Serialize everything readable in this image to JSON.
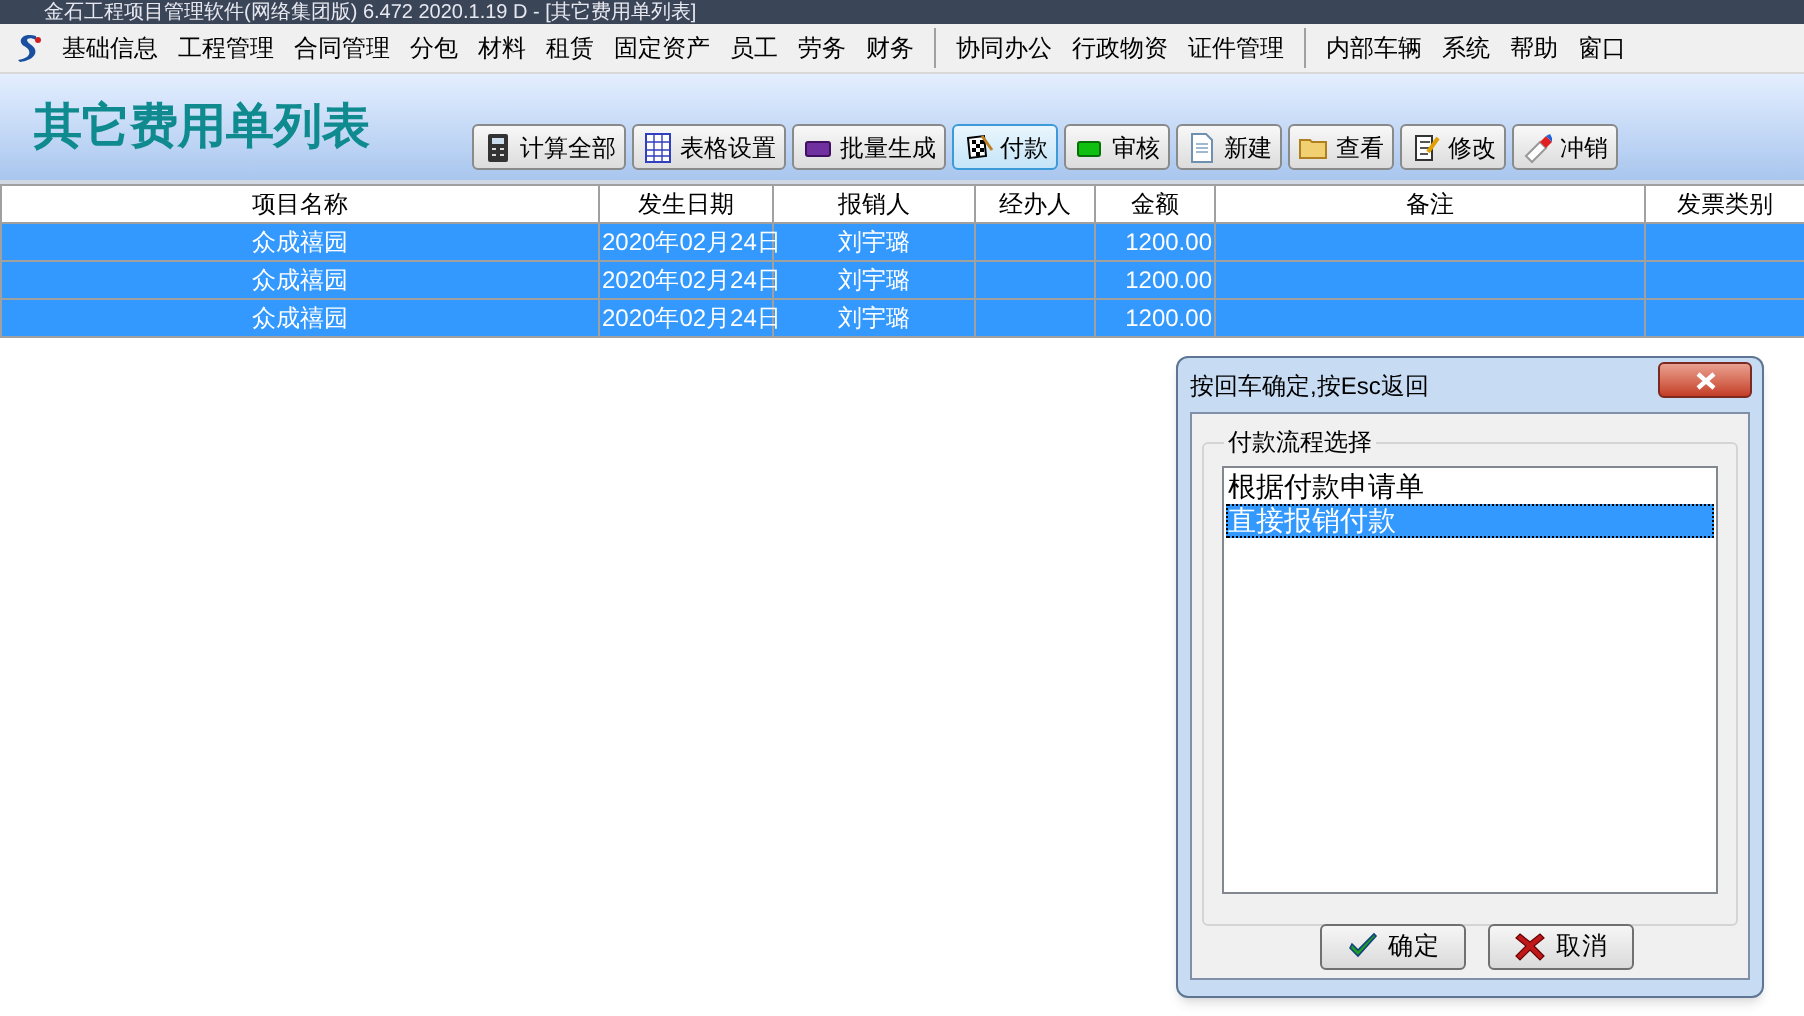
{
  "window": {
    "title": "金石工程项目管理软件(网络集团版) 6.472  2020.1.19 D - [其它费用单列表]"
  },
  "menu": [
    {
      "label": "基础信息"
    },
    {
      "label": "工程管理"
    },
    {
      "label": "合同管理"
    },
    {
      "label": "分包"
    },
    {
      "label": "材料"
    },
    {
      "label": "租赁"
    },
    {
      "label": "固定资产"
    },
    {
      "label": "员工"
    },
    {
      "label": "劳务"
    },
    {
      "label": "财务"
    },
    {
      "kind": "separator"
    },
    {
      "label": "协同办公"
    },
    {
      "label": "行政物资"
    },
    {
      "label": "证件管理"
    },
    {
      "kind": "separator"
    },
    {
      "label": "内部车辆"
    },
    {
      "label": "系统"
    },
    {
      "label": "帮助"
    },
    {
      "label": "窗口"
    }
  ],
  "page_title": "其它费用单列表",
  "toolbar": [
    {
      "label": "计算全部",
      "selected": false
    },
    {
      "label": "表格设置",
      "selected": false
    },
    {
      "label": "批量生成",
      "selected": false
    },
    {
      "label": "付款",
      "selected": true
    },
    {
      "label": "审核",
      "selected": false
    },
    {
      "label": "新建",
      "selected": false
    },
    {
      "label": "查看",
      "selected": false
    },
    {
      "label": "修改",
      "selected": false
    },
    {
      "label": "冲销",
      "selected": false
    }
  ],
  "table": {
    "columns": [
      "项目名称",
      "发生日期",
      "报销人",
      "经办人",
      "金额",
      "备注",
      "发票类别"
    ],
    "rows": [
      {
        "cells": [
          "众成禧园",
          "2020年02月24日",
          "刘宇璐",
          "",
          "1200.00",
          "",
          ""
        ],
        "selected": true
      },
      {
        "cells": [
          "众成禧园",
          "2020年02月24日",
          "刘宇璐",
          "",
          "1200.00",
          "",
          ""
        ],
        "selected": true
      },
      {
        "cells": [
          "众成禧园",
          "2020年02月24日",
          "刘宇璐",
          "",
          "1200.00",
          "",
          ""
        ],
        "selected": true
      }
    ]
  },
  "dialog": {
    "title": "按回车确定,按Esc返回",
    "group": "付款流程选择",
    "options": [
      {
        "label": "根据付款申请单",
        "selected": false
      },
      {
        "label": "直接报销付款",
        "selected": true
      }
    ],
    "buttons": [
      {
        "label": "确定",
        "kind": "ok"
      },
      {
        "label": "取消",
        "kind": "cancel"
      }
    ]
  }
}
